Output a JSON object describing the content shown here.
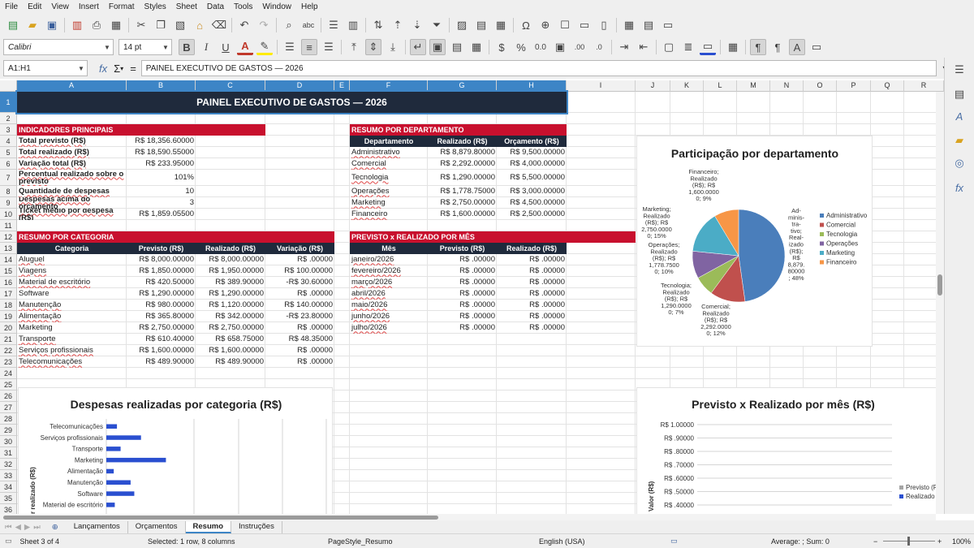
{
  "menu": [
    "File",
    "Edit",
    "View",
    "Insert",
    "Format",
    "Styles",
    "Sheet",
    "Data",
    "Tools",
    "Window",
    "Help"
  ],
  "font": {
    "name": "Calibri",
    "size": "14 pt"
  },
  "formula": {
    "cellref": "A1:H1",
    "content": "PAINEL EXECUTIVO DE GASTOS — 2026"
  },
  "columns": [
    "A",
    "B",
    "C",
    "D",
    "E",
    "F",
    "G",
    "H",
    "I",
    "J",
    "K",
    "L",
    "M",
    "N",
    "O",
    "P",
    "Q",
    "R"
  ],
  "rows": [
    "1",
    "2",
    "3",
    "4",
    "5",
    "6",
    "7",
    "8",
    "9",
    "10",
    "11",
    "12",
    "13",
    "14",
    "15",
    "16",
    "17",
    "18",
    "19",
    "20",
    "21",
    "22",
    "23",
    "24",
    "25",
    "26",
    "27",
    "28",
    "29",
    "30",
    "31",
    "32",
    "33",
    "34",
    "35",
    "36"
  ],
  "title": "PAINEL EXECUTIVO DE GASTOS — 2026",
  "indicators": {
    "header": "INDICADORES PRINCIPAIS",
    "rows": [
      {
        "label": "Total previsto (R$)",
        "value": "R$ 18,356.60000"
      },
      {
        "label": "Total realizado (R$)",
        "value": "R$ 18,590.55000"
      },
      {
        "label": "Variação total (R$)",
        "value": "R$ 233.95000"
      },
      {
        "label": "Percentual realizado sobre o previsto",
        "value": "101%"
      },
      {
        "label": "Quantidade de despesas",
        "value": "10"
      },
      {
        "label": "Despesas acima do orçamento",
        "value": "3"
      },
      {
        "label": "Ticket médio por despesa (R$)",
        "value": "R$ 1,859.05500"
      }
    ]
  },
  "dept": {
    "header": "RESUMO POR DEPARTAMENTO",
    "cols": [
      "Departamento",
      "Realizado (R$)",
      "Orçamento (R$)"
    ],
    "rows": [
      [
        "Administrativo",
        "R$ 8,879.80000",
        "R$ 9,500.00000"
      ],
      [
        "Comercial",
        "R$ 2,292.00000",
        "R$ 4,000.00000"
      ],
      [
        "Tecnologia",
        "R$ 1,290.00000",
        "R$ 5,500.00000"
      ],
      [
        "Operações",
        "R$ 1,778.75000",
        "R$ 3,000.00000"
      ],
      [
        "Marketing",
        "R$ 2,750.00000",
        "R$ 4,500.00000"
      ],
      [
        "Financeiro",
        "R$ 1,600.00000",
        "R$ 2,500.00000"
      ]
    ]
  },
  "category": {
    "header": "RESUMO POR CATEGORIA",
    "cols": [
      "Categoria",
      "Previsto (R$)",
      "Realizado (R$)",
      "Variação (R$)"
    ],
    "rows": [
      [
        "Aluguel",
        "R$ 8,000.00000",
        "R$ 8,000.00000",
        "R$ .00000"
      ],
      [
        "Viagens",
        "R$ 1,850.00000",
        "R$ 1,950.00000",
        "R$ 100.00000"
      ],
      [
        "Material de escritório",
        "R$ 420.50000",
        "R$ 389.90000",
        "-R$ 30.60000"
      ],
      [
        "Software",
        "R$ 1,290.00000",
        "R$ 1,290.00000",
        "R$ .00000"
      ],
      [
        "Manutenção",
        "R$ 980.00000",
        "R$ 1,120.00000",
        "R$ 140.00000"
      ],
      [
        "Alimentação",
        "R$ 365.80000",
        "R$ 342.00000",
        "-R$ 23.80000"
      ],
      [
        "Marketing",
        "R$ 2,750.00000",
        "R$ 2,750.00000",
        "R$ .00000"
      ],
      [
        "Transporte",
        "R$ 610.40000",
        "R$ 658.75000",
        "R$ 48.35000"
      ],
      [
        "Serviços profissionais",
        "R$ 1,600.00000",
        "R$ 1,600.00000",
        "R$ .00000"
      ],
      [
        "Telecomunicações",
        "R$ 489.90000",
        "R$ 489.90000",
        "R$ .00000"
      ]
    ]
  },
  "monthly": {
    "header": "PREVISTO x REALIZADO POR MÊS",
    "cols": [
      "Mês",
      "Previsto (R$)",
      "Realizado (R$)"
    ],
    "rows": [
      [
        "janeiro/2026",
        "R$ .00000",
        "R$ .00000"
      ],
      [
        "fevereiro/2026",
        "R$ .00000",
        "R$ .00000"
      ],
      [
        "março/2026",
        "R$ .00000",
        "R$ .00000"
      ],
      [
        "abril/2026",
        "R$ .00000",
        "R$ .00000"
      ],
      [
        "maio/2026",
        "R$ .00000",
        "R$ .00000"
      ],
      [
        "junho/2026",
        "R$ .00000",
        "R$ .00000"
      ],
      [
        "julho/2026",
        "R$ .00000",
        "R$ .00000"
      ]
    ]
  },
  "chart_data": [
    {
      "type": "pie",
      "title": "Participação por departamento",
      "categories": [
        "Administrativo",
        "Comercial",
        "Tecnologia",
        "Operações",
        "Marketing",
        "Financeiro"
      ],
      "values": [
        8879.8,
        2292.0,
        1290.0,
        1778.75,
        2750.0,
        1600.0
      ],
      "colors": [
        "#4a7ebb",
        "#c0504d",
        "#9bbb59",
        "#8064a2",
        "#4bacc6",
        "#f79646"
      ],
      "labels": [
        "Ad-\nminis-\ntra-\ntivo;\nReal-\nizado\n(R$);\nR$\n8,879.\n80000\n; 48%",
        "Comercial;\nRealizado\n(R$); R$\n2,292.0000\n0; 12%",
        "Tecnologia;\nRealizado\n(R$); R$\n1,290.0000\n0; 7%",
        "Operações;\nRealizado\n(R$); R$\n1,778.7500\n0; 10%",
        "Marketing;\nRealizado\n(R$); R$\n2,750.0000\n0; 15%",
        "Financeiro;\nRealizado\n(R$); R$\n1,600.0000\n0; 9%"
      ],
      "legend": "right"
    },
    {
      "type": "bar",
      "title": "Despesas realizadas por categoria (R$)",
      "ylabel": "r realizado (R$)",
      "categories": [
        "Telecomunicações",
        "Serviços profissionais",
        "Transporte",
        "Marketing",
        "Alimentação",
        "Manutenção",
        "Software",
        "Material de escritório"
      ],
      "values": [
        489.9,
        1600.0,
        658.75,
        2750.0,
        342.0,
        1120.0,
        1290.0,
        389.9
      ],
      "color": "#2a4fd0",
      "orientation": "horizontal"
    },
    {
      "type": "line",
      "title": "Previsto x Realizado por mês (R$)",
      "ylabel": "Valor (R$)",
      "ytick_labels": [
        "R$ 1.00000",
        "R$ .90000",
        "R$ .80000",
        "R$ .70000",
        "R$ .60000",
        "R$ .50000",
        "R$ .40000"
      ],
      "series": [
        {
          "name": "Previsto (R",
          "color": "#a5a5a5"
        },
        {
          "name": "Realizado",
          "color": "#2a4fd0"
        }
      ],
      "legend": "right"
    }
  ],
  "tabs": [
    "Lançamentos",
    "Orçamentos",
    "Resumo",
    "Instruções"
  ],
  "active_tab": "Resumo",
  "status": {
    "sheet": "Sheet 3 of 4",
    "selection": "Selected: 1 row, 8 columns",
    "pagestyle": "PageStyle_Resumo",
    "lang": "English (USA)",
    "sum": "Average: ; Sum: 0",
    "zoom": "100%"
  }
}
